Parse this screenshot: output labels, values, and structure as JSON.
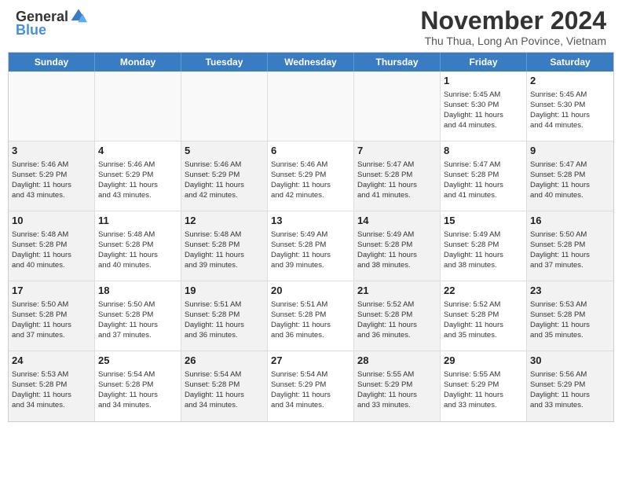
{
  "header": {
    "logo_general": "General",
    "logo_blue": "Blue",
    "month_title": "November 2024",
    "subtitle": "Thu Thua, Long An Povince, Vietnam"
  },
  "weekdays": [
    "Sunday",
    "Monday",
    "Tuesday",
    "Wednesday",
    "Thursday",
    "Friday",
    "Saturday"
  ],
  "weeks": [
    [
      {
        "day": "",
        "info": "",
        "empty": true
      },
      {
        "day": "",
        "info": "",
        "empty": true
      },
      {
        "day": "",
        "info": "",
        "empty": true
      },
      {
        "day": "",
        "info": "",
        "empty": true
      },
      {
        "day": "",
        "info": "",
        "empty": true
      },
      {
        "day": "1",
        "info": "Sunrise: 5:45 AM\nSunset: 5:30 PM\nDaylight: 11 hours\nand 44 minutes."
      },
      {
        "day": "2",
        "info": "Sunrise: 5:45 AM\nSunset: 5:30 PM\nDaylight: 11 hours\nand 44 minutes."
      }
    ],
    [
      {
        "day": "3",
        "info": "Sunrise: 5:46 AM\nSunset: 5:29 PM\nDaylight: 11 hours\nand 43 minutes.",
        "shaded": true
      },
      {
        "day": "4",
        "info": "Sunrise: 5:46 AM\nSunset: 5:29 PM\nDaylight: 11 hours\nand 43 minutes."
      },
      {
        "day": "5",
        "info": "Sunrise: 5:46 AM\nSunset: 5:29 PM\nDaylight: 11 hours\nand 42 minutes.",
        "shaded": true
      },
      {
        "day": "6",
        "info": "Sunrise: 5:46 AM\nSunset: 5:29 PM\nDaylight: 11 hours\nand 42 minutes."
      },
      {
        "day": "7",
        "info": "Sunrise: 5:47 AM\nSunset: 5:28 PM\nDaylight: 11 hours\nand 41 minutes.",
        "shaded": true
      },
      {
        "day": "8",
        "info": "Sunrise: 5:47 AM\nSunset: 5:28 PM\nDaylight: 11 hours\nand 41 minutes."
      },
      {
        "day": "9",
        "info": "Sunrise: 5:47 AM\nSunset: 5:28 PM\nDaylight: 11 hours\nand 40 minutes.",
        "shaded": true
      }
    ],
    [
      {
        "day": "10",
        "info": "Sunrise: 5:48 AM\nSunset: 5:28 PM\nDaylight: 11 hours\nand 40 minutes.",
        "shaded": true
      },
      {
        "day": "11",
        "info": "Sunrise: 5:48 AM\nSunset: 5:28 PM\nDaylight: 11 hours\nand 40 minutes."
      },
      {
        "day": "12",
        "info": "Sunrise: 5:48 AM\nSunset: 5:28 PM\nDaylight: 11 hours\nand 39 minutes.",
        "shaded": true
      },
      {
        "day": "13",
        "info": "Sunrise: 5:49 AM\nSunset: 5:28 PM\nDaylight: 11 hours\nand 39 minutes."
      },
      {
        "day": "14",
        "info": "Sunrise: 5:49 AM\nSunset: 5:28 PM\nDaylight: 11 hours\nand 38 minutes.",
        "shaded": true
      },
      {
        "day": "15",
        "info": "Sunrise: 5:49 AM\nSunset: 5:28 PM\nDaylight: 11 hours\nand 38 minutes."
      },
      {
        "day": "16",
        "info": "Sunrise: 5:50 AM\nSunset: 5:28 PM\nDaylight: 11 hours\nand 37 minutes.",
        "shaded": true
      }
    ],
    [
      {
        "day": "17",
        "info": "Sunrise: 5:50 AM\nSunset: 5:28 PM\nDaylight: 11 hours\nand 37 minutes.",
        "shaded": true
      },
      {
        "day": "18",
        "info": "Sunrise: 5:50 AM\nSunset: 5:28 PM\nDaylight: 11 hours\nand 37 minutes."
      },
      {
        "day": "19",
        "info": "Sunrise: 5:51 AM\nSunset: 5:28 PM\nDaylight: 11 hours\nand 36 minutes.",
        "shaded": true
      },
      {
        "day": "20",
        "info": "Sunrise: 5:51 AM\nSunset: 5:28 PM\nDaylight: 11 hours\nand 36 minutes."
      },
      {
        "day": "21",
        "info": "Sunrise: 5:52 AM\nSunset: 5:28 PM\nDaylight: 11 hours\nand 36 minutes.",
        "shaded": true
      },
      {
        "day": "22",
        "info": "Sunrise: 5:52 AM\nSunset: 5:28 PM\nDaylight: 11 hours\nand 35 minutes."
      },
      {
        "day": "23",
        "info": "Sunrise: 5:53 AM\nSunset: 5:28 PM\nDaylight: 11 hours\nand 35 minutes.",
        "shaded": true
      }
    ],
    [
      {
        "day": "24",
        "info": "Sunrise: 5:53 AM\nSunset: 5:28 PM\nDaylight: 11 hours\nand 34 minutes.",
        "shaded": true
      },
      {
        "day": "25",
        "info": "Sunrise: 5:54 AM\nSunset: 5:28 PM\nDaylight: 11 hours\nand 34 minutes."
      },
      {
        "day": "26",
        "info": "Sunrise: 5:54 AM\nSunset: 5:28 PM\nDaylight: 11 hours\nand 34 minutes.",
        "shaded": true
      },
      {
        "day": "27",
        "info": "Sunrise: 5:54 AM\nSunset: 5:29 PM\nDaylight: 11 hours\nand 34 minutes."
      },
      {
        "day": "28",
        "info": "Sunrise: 5:55 AM\nSunset: 5:29 PM\nDaylight: 11 hours\nand 33 minutes.",
        "shaded": true
      },
      {
        "day": "29",
        "info": "Sunrise: 5:55 AM\nSunset: 5:29 PM\nDaylight: 11 hours\nand 33 minutes."
      },
      {
        "day": "30",
        "info": "Sunrise: 5:56 AM\nSunset: 5:29 PM\nDaylight: 11 hours\nand 33 minutes.",
        "shaded": true
      }
    ]
  ]
}
